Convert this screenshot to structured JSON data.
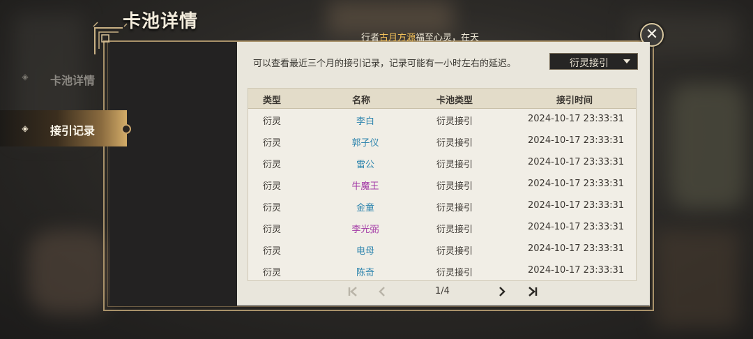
{
  "title": "卡池详情",
  "marquee": {
    "prefix": "行者",
    "highlight": "古月方源",
    "suffix": "福至心灵，在天"
  },
  "close_icon": "close-icon",
  "sidebar": {
    "items": [
      {
        "label": "卡池详情",
        "active": false
      },
      {
        "label": "接引记录",
        "active": true
      }
    ]
  },
  "notice": "可以查看最近三个月的接引记录，记录可能有一小时左右的延迟。",
  "dropdown": {
    "selected": "衍灵接引"
  },
  "table": {
    "headers": [
      "类型",
      "名称",
      "卡池类型",
      "接引时间"
    ],
    "rows": [
      {
        "type": "衍灵",
        "name": "李白",
        "name_color": "blue",
        "pool": "衍灵接引",
        "time": "2024-10-17 23:33:31"
      },
      {
        "type": "衍灵",
        "name": "郭子仪",
        "name_color": "blue",
        "pool": "衍灵接引",
        "time": "2024-10-17 23:33:31"
      },
      {
        "type": "衍灵",
        "name": "雷公",
        "name_color": "blue",
        "pool": "衍灵接引",
        "time": "2024-10-17 23:33:31"
      },
      {
        "type": "衍灵",
        "name": "牛魔王",
        "name_color": "purple",
        "pool": "衍灵接引",
        "time": "2024-10-17 23:33:31"
      },
      {
        "type": "衍灵",
        "name": "金童",
        "name_color": "blue",
        "pool": "衍灵接引",
        "time": "2024-10-17 23:33:31"
      },
      {
        "type": "衍灵",
        "name": "李光弼",
        "name_color": "purple",
        "pool": "衍灵接引",
        "time": "2024-10-17 23:33:31"
      },
      {
        "type": "衍灵",
        "name": "电母",
        "name_color": "blue",
        "pool": "衍灵接引",
        "time": "2024-10-17 23:33:31"
      },
      {
        "type": "衍灵",
        "name": "陈奇",
        "name_color": "blue",
        "pool": "衍灵接引",
        "time": "2024-10-17 23:33:31"
      }
    ]
  },
  "pagination": {
    "current": 1,
    "total": 4,
    "text": "1/4"
  },
  "colors": {
    "accent_gold": "#f3c15a",
    "name_blue": "#2d84ad",
    "name_purple": "#a33aa6",
    "panel_bg": "#e9e6dc"
  }
}
